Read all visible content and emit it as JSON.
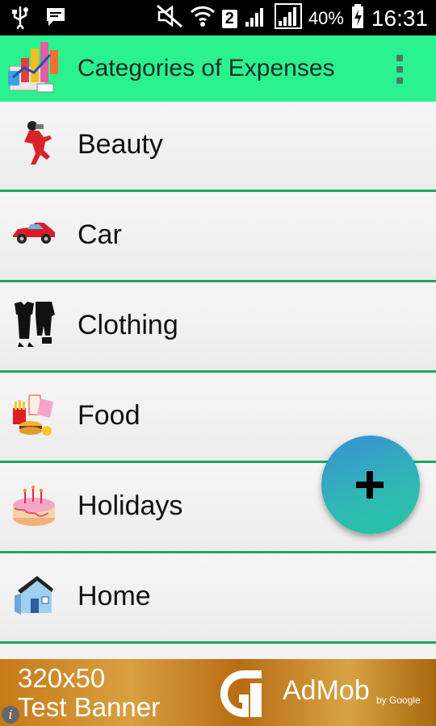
{
  "status_bar": {
    "battery": "40%",
    "time": "16:31",
    "sim_slot": "2"
  },
  "app_bar": {
    "title": "Categories of Expenses",
    "accent_color": "#2af28e"
  },
  "categories": [
    {
      "label": "Beauty",
      "icon": "beauty-icon"
    },
    {
      "label": "Car",
      "icon": "car-icon"
    },
    {
      "label": "Clothing",
      "icon": "clothing-icon"
    },
    {
      "label": "Food",
      "icon": "food-icon"
    },
    {
      "label": "Holidays",
      "icon": "cake-icon"
    },
    {
      "label": "Home",
      "icon": "home-icon"
    }
  ],
  "fab": {
    "icon": "plus-icon"
  },
  "ad_banner": {
    "line1": "320x50",
    "line2": "Test Banner",
    "brand": "AdMob",
    "by": "by Google"
  }
}
